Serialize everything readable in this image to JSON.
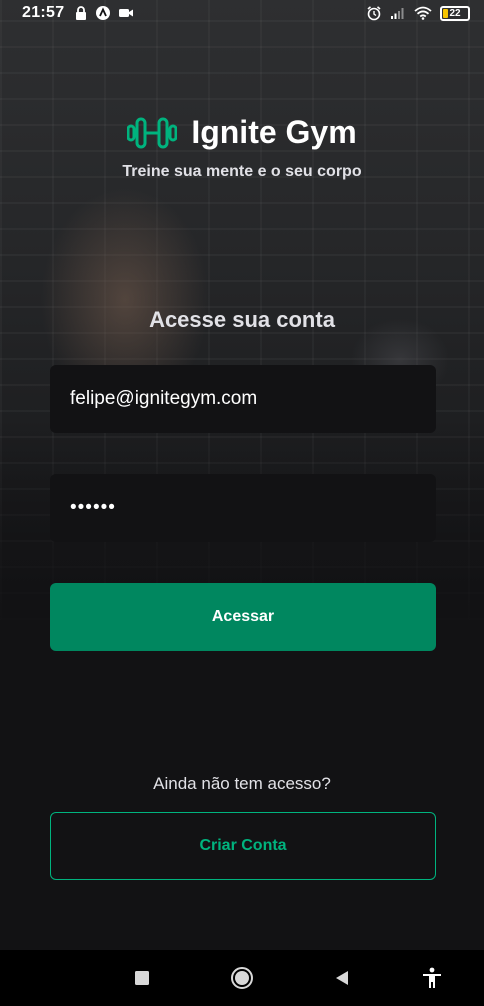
{
  "status_bar": {
    "time": "21:57",
    "left_icons": [
      "lock-icon",
      "app-icon",
      "video-camera-icon"
    ],
    "right_icons": [
      "alarm-icon",
      "signal-icon",
      "wifi-icon"
    ],
    "battery_level": "22",
    "battery_color": "#f5c400"
  },
  "brand": {
    "name": "Ignite Gym",
    "tagline": "Treine sua mente e o seu corpo",
    "accent_color": "#00b37e"
  },
  "login": {
    "heading": "Acesse sua conta",
    "email_value": "felipe@ignitegym.com",
    "password_value": "••••••",
    "submit_label": "Acessar",
    "submit_color": "#00875f"
  },
  "signup": {
    "question": "Ainda não tem acesso?",
    "button_label": "Criar Conta"
  },
  "nav_bar": {
    "buttons": [
      "recents-icon",
      "home-icon",
      "back-icon",
      "accessibility-icon"
    ]
  }
}
